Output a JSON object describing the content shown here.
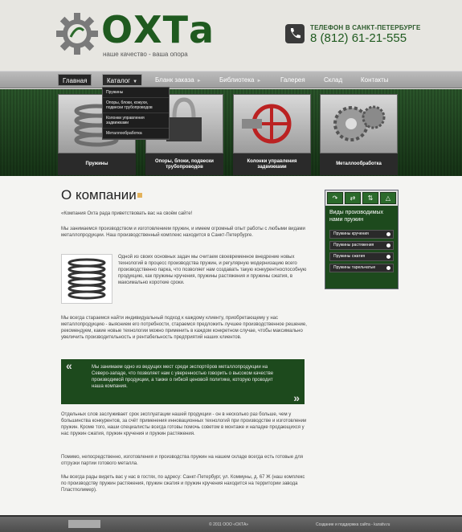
{
  "brand": {
    "logo_text": "ОХТа",
    "slogan": "наше качество - ваша опора"
  },
  "phone": {
    "label": "ТЕЛЕФОН В САНКТ-ПЕТЕРБУРГЕ",
    "number": "8 (812) 61-21-555"
  },
  "nav": [
    {
      "label": "Главная",
      "active": true
    },
    {
      "label": "Каталог",
      "active": false
    },
    {
      "label": "Бланк заказа",
      "active": false
    },
    {
      "label": "Библиотека",
      "active": false
    },
    {
      "label": "Галерея",
      "active": false
    },
    {
      "label": "Склад",
      "active": false
    },
    {
      "label": "Контакты",
      "active": false
    }
  ],
  "dropdown": [
    "Пружины",
    "Опоры, блоки, кожухи, подвески трубопроводов",
    "Колонки управления задвижками",
    "Металлообработка"
  ],
  "cards": [
    {
      "caption": "Пружины"
    },
    {
      "caption": "Опоры, блоки, подвески трубопроводов"
    },
    {
      "caption": "Колонки управления задвижками"
    },
    {
      "caption": "Металлообработка"
    }
  ],
  "page": {
    "title": "О компании",
    "p1": "«Компания Охта рада приветствовать вас на своём сайте!",
    "p2": "Мы занимаемся производством и изготовлением пружин, и имеем огромный опыт работы с любыми видами металлопродукции. Наш производственный комплекс находится в Санкт-Петербурге.",
    "p3": "Одной из своих основных задач мы считаем своевременное внедрение новых технологий в процесс производства пружин, и регулярную модернизацию всего производственно парка, что позволяет нам создавать такую конкурентноспособную продукцию, как пружины кручения, пружины растяжения и пружины сжатия, в максимально короткие сроки.",
    "p4": "Мы всегда стараемся найти индивидуальный подход к каждому клиенту, приобретающему у нас металлопродукцию - выяснием его потребности, стараемся предложить лучшее производственное решение, рекомендуем, какие новые технологии можно применить в каждом конкретном случае, чтобы максимально увеличить производительность и рентабельность предприятий наших клиентов.",
    "quote": "Мы занимаем одно из ведущих мест среди экспортёров металлопродукции на Северо-западе, что позволяет нам с уверенностью говорить о высоком качестве производимой продукции, а также о гибкой ценовой политике, которую проводит наша компания.",
    "p5": "Отдельных слов заслуживает срок эксплуатации нашей продукции - он в несколько раз больше, чем у большинства конкурентов, за счёт применения инновационных технологий при производстве и изготовлении пружин. Кроме того, наши специалисты всегда готовы помочь советом в монтаже и наладке продающихся у нас пружин сжатия, пружин кручения и пружин растяжения.",
    "p6": "Помимо, непосредственно, изготовления и производства пружин на нашем складе всегда есть готовые для отгрузки партии готового металла.",
    "p7": "Мы всегда рады видеть вас у нас в гостях, по адресу: Санкт-Петербург, ул. Коммуны, д. 67 Ж (наш комплекс по производству пружин растяжения, пружин сжатия и пружин кручения находится на территории завода Пластполимер)."
  },
  "sidebar": {
    "title": "Виды производимых нами пружин",
    "items": [
      "Пружины кручения",
      "Пружины растяжения",
      "Пружины сжатия",
      "Пружины тарельчатые"
    ]
  },
  "footer": {
    "copyright": "© 2011 ООО «ОХТА»",
    "developer": "Создание и поддержка сайта - kurativ.ru"
  },
  "colors": {
    "brand_green": "#1f5a1f",
    "banner_green": "#1f3f1f",
    "nav_gray": "#9d9d9d"
  }
}
